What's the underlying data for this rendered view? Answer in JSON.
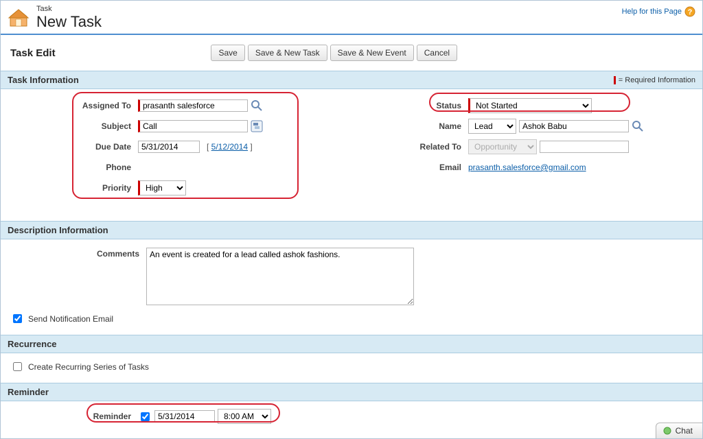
{
  "header": {
    "small": "Task",
    "big": "New Task",
    "help": "Help for this Page"
  },
  "toolbar": {
    "title": "Task Edit",
    "buttons": {
      "save": "Save",
      "saveNewTask": "Save & New Task",
      "saveNewEvent": "Save & New Event",
      "cancel": "Cancel"
    }
  },
  "sections": {
    "taskInfo": {
      "title": "Task Information",
      "reqLegend": "= Required Information",
      "left": {
        "assignedToLabel": "Assigned To",
        "assignedToValue": "prasanth salesforce",
        "subjectLabel": "Subject",
        "subjectValue": "Call",
        "dueDateLabel": "Due Date",
        "dueDateValue": "5/31/2014",
        "dueDateHint": "5/12/2014",
        "phoneLabel": "Phone",
        "priorityLabel": "Priority",
        "priorityValue": "High"
      },
      "right": {
        "statusLabel": "Status",
        "statusValue": "Not Started",
        "nameLabel": "Name",
        "nameTypeValue": "Lead",
        "nameValue": "Ashok Babu",
        "relatedToLabel": "Related To",
        "relatedToType": "Opportunity",
        "relatedToValue": "",
        "emailLabel": "Email",
        "emailValue": "prasanth.salesforce@gmail.com"
      }
    },
    "desc": {
      "title": "Description Information",
      "commentsLabel": "Comments",
      "commentsValue": "An event is created for a lead called ashok fashions.",
      "sendNotif": "Send Notification Email"
    },
    "recurrence": {
      "title": "Recurrence",
      "createRecurring": "Create Recurring Series of Tasks"
    },
    "reminder": {
      "title": "Reminder",
      "label": "Reminder",
      "dateValue": "5/31/2014",
      "timeValue": "8:00 AM"
    }
  },
  "chat": {
    "label": "Chat"
  }
}
